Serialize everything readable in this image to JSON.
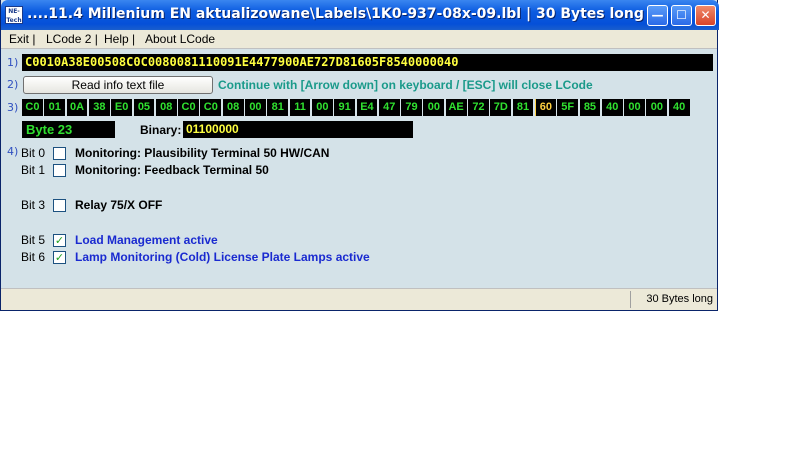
{
  "window": {
    "icon_text": "NE-Tech",
    "title": "....11.4 Millenium EN aktualizowane\\Labels\\1K0-937-08x-09.lbl | 30 Bytes long"
  },
  "menu": [
    "Exit |",
    "LCode 2 |",
    "Help |",
    "About LCode"
  ],
  "row_labels": [
    "1)",
    "2)",
    "3)",
    "4)"
  ],
  "hex_string": "C0010A38E00508C0C0080081110091E4477900AE727D81605F8540000040",
  "read_button_label": "Read info text file",
  "hint": "Continue with [Arrow down] on keyboard / [ESC] will close LCode",
  "bytes": [
    "C0",
    "01",
    "0A",
    "38",
    "E0",
    "05",
    "08",
    "C0",
    "C0",
    "08",
    "00",
    "81",
    "11",
    "00",
    "91",
    "E4",
    "47",
    "79",
    "00",
    "AE",
    "72",
    "7D",
    "81",
    "60",
    "5F",
    "85",
    "40",
    "00",
    "00",
    "40"
  ],
  "selected_byte_index": 23,
  "byte_label": "Byte 23",
  "binary_label": "Binary:",
  "binary_value": "01100000",
  "bits": [
    {
      "label": "Bit 0",
      "text": "Monitoring: Plausibility Terminal 50 HW/CAN",
      "checked": false,
      "color": "#000000"
    },
    {
      "label": "Bit 1",
      "text": "Monitoring: Feedback Terminal 50",
      "checked": false,
      "color": "#000000"
    },
    {
      "label": "Bit 3",
      "text": "Relay 75/X OFF",
      "checked": false,
      "color": "#000000"
    },
    {
      "label": "Bit 5",
      "text": "Load Management active",
      "checked": true,
      "color": "#1a2ad0"
    },
    {
      "label": "Bit 6",
      "text": "Lamp Monitoring (Cold) License Plate Lamps active",
      "checked": true,
      "color": "#1a2ad0"
    }
  ],
  "status": "30 Bytes long",
  "colors": {
    "hex_text": "#ffff40",
    "byte_text": "#30e030",
    "selected_byte": "#ffd040",
    "hint": "#1a9a8a",
    "active_bit": "#1a2ad0"
  }
}
